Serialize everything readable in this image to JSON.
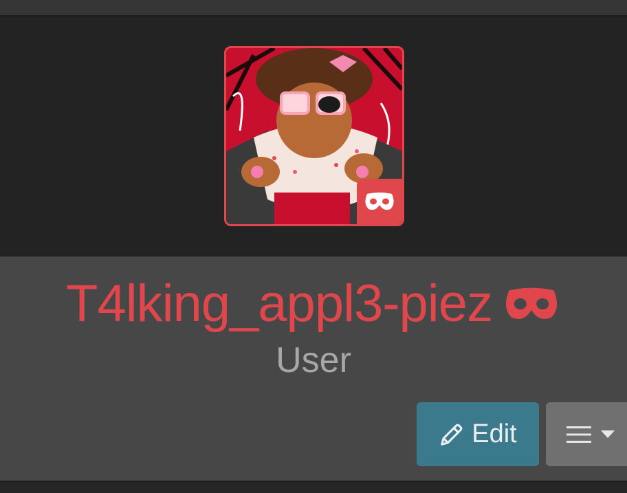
{
  "profile": {
    "username": "T4lking_appl3-piez",
    "role": "User",
    "username_icon": "mask-icon",
    "avatar_badge_icon": "mask-icon"
  },
  "actions": {
    "edit_label": "Edit",
    "edit_icon": "pencil-icon",
    "menu_icon": "hamburger-icon",
    "menu_caret_icon": "caret-down-icon"
  },
  "colors": {
    "accent": "#e0474c",
    "edit_button": "#3a7a8c",
    "menu_button": "#707070",
    "role_text": "#a7a7a7",
    "cover_bg": "#232323",
    "info_bg": "#474747"
  }
}
